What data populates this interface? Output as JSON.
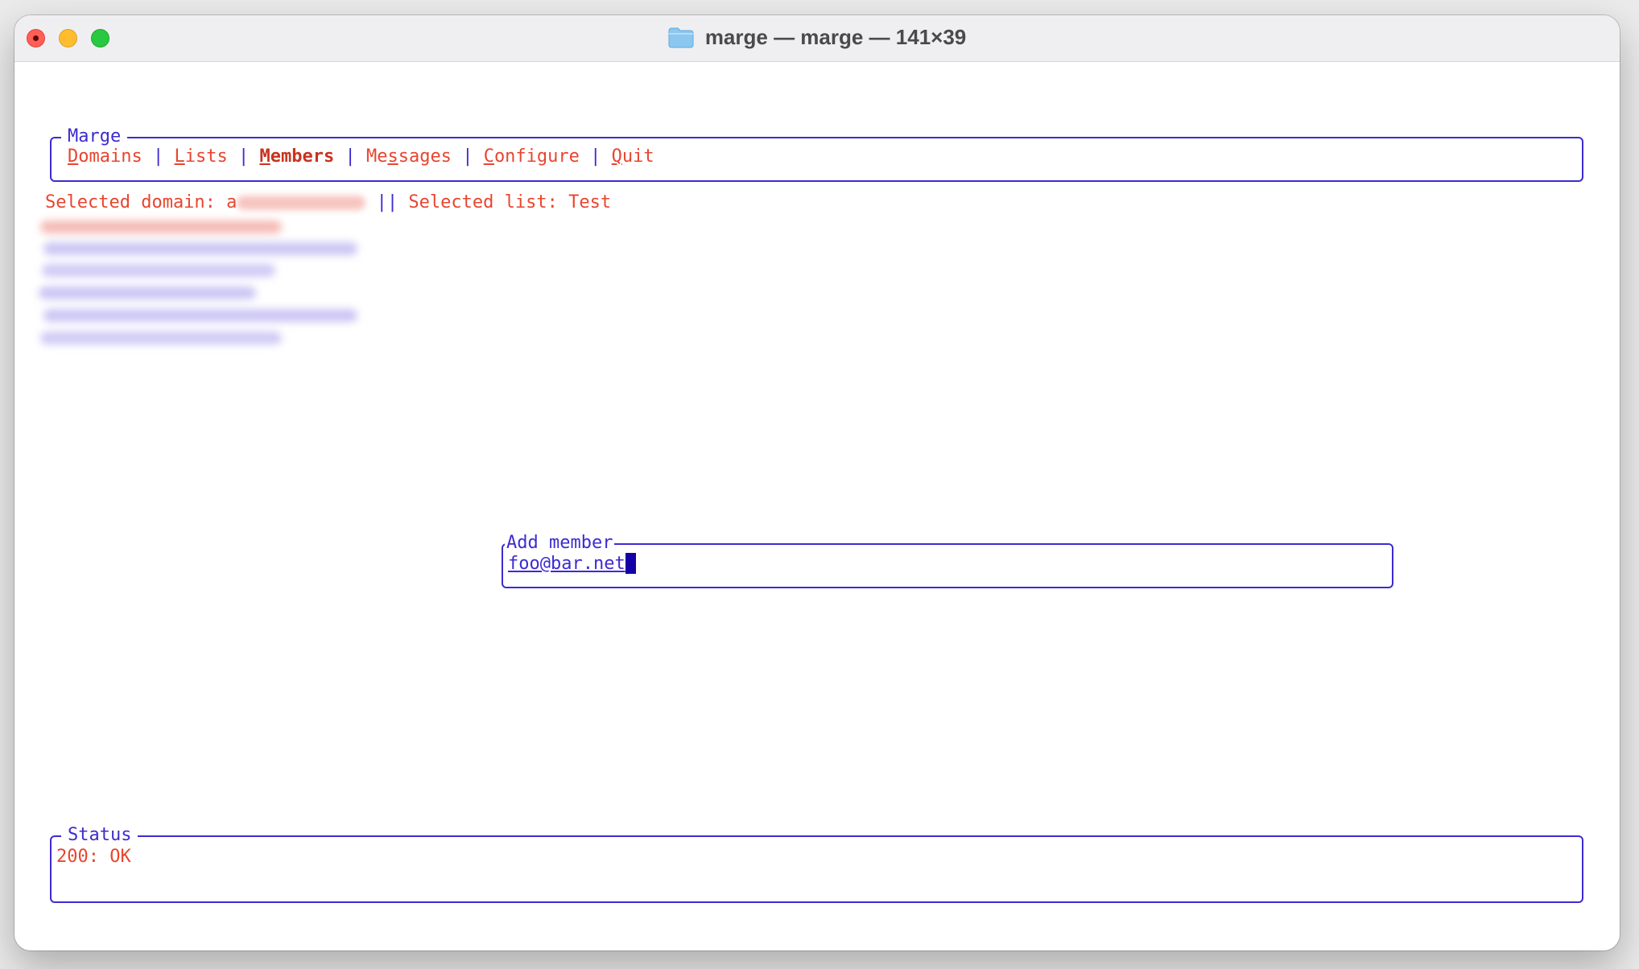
{
  "window": {
    "title": "marge — marge — 141×39",
    "title_icon": "folder-icon",
    "controls": [
      "close",
      "minimize",
      "zoom"
    ]
  },
  "menu": {
    "title": "Marge",
    "items": [
      {
        "hotkey": "D",
        "rest": "omains",
        "active": false
      },
      {
        "hotkey": "L",
        "rest": "ists",
        "active": false
      },
      {
        "hotkey": "M",
        "rest": "embers",
        "active": true
      },
      {
        "pre": "Me",
        "hotkey": "s",
        "rest": "sages",
        "active": false
      },
      {
        "hotkey": "C",
        "rest": "onfigure",
        "active": false
      },
      {
        "hotkey": "Q",
        "rest": "uit",
        "active": false
      }
    ],
    "separator": "|"
  },
  "selection": {
    "domain_label": "Selected domain: ",
    "domain_value_prefix": "a",
    "divider": "||",
    "list_label": "Selected list: ",
    "list_value": "Test"
  },
  "add_member": {
    "title": "Add member",
    "value": "foo@bar.net"
  },
  "status": {
    "title": "Status",
    "text": "200: OK"
  },
  "colors": {
    "border_accent": "#3c2bd1",
    "text_red": "#e8452f",
    "cursor": "#1400a8",
    "window_bg": "#ffffff",
    "titlebar_bg": "#efeff1"
  }
}
